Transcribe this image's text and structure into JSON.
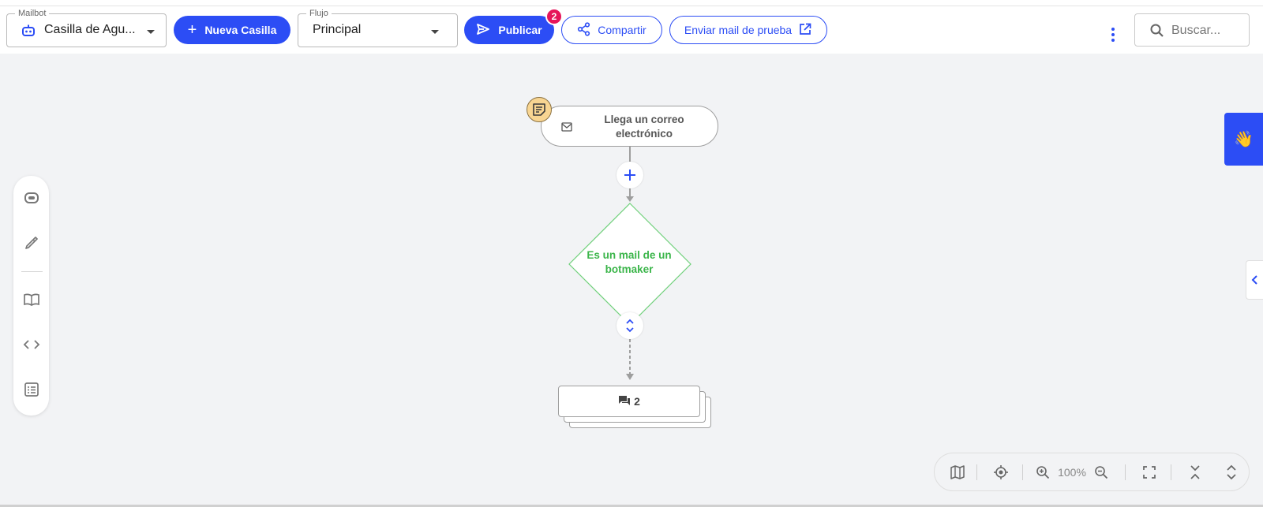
{
  "toolbar": {
    "mailbot": {
      "legend": "Mailbot",
      "value": "Casilla de Agu...",
      "icon": "robot-icon"
    },
    "new_mailbox_label": "Nueva Casilla",
    "flow": {
      "legend": "Flujo",
      "value": "Principal"
    },
    "publish_label": "Publicar",
    "publish_badge": "2",
    "share_label": "Compartir",
    "test_mail_label": "Enviar mail de prueba",
    "search_placeholder": "Buscar..."
  },
  "left_toolbar": {
    "items": [
      "bot-icon",
      "brush-icon",
      "book-icon",
      "code-icon",
      "list-icon"
    ]
  },
  "flow": {
    "start_node_label": "Llega un correo electrónico",
    "decision_label": "Es un mail de un botmaker",
    "stack_count": "2"
  },
  "zoom": {
    "level": "100%"
  },
  "colors": {
    "accent": "#2c4df5",
    "badge": "#e6145a",
    "decision": "#3bb54a",
    "note": "#f8d592"
  }
}
